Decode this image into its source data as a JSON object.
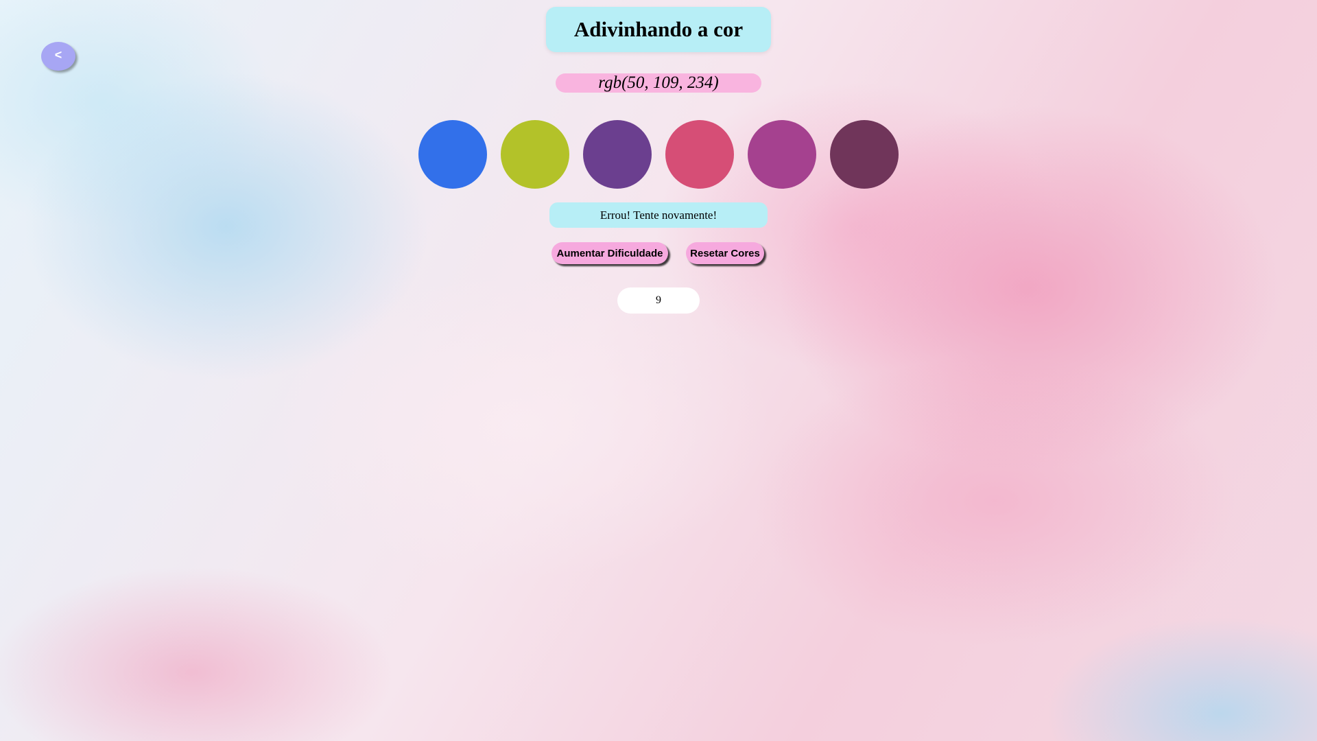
{
  "nav": {
    "back_label": "<"
  },
  "header": {
    "title": "Adivinhando a cor"
  },
  "target": {
    "rgb_text": "rgb(50, 109, 234)"
  },
  "colors": [
    {
      "name": "color-option-1",
      "hex": "#3270ea"
    },
    {
      "name": "color-option-2",
      "hex": "#b3c229"
    },
    {
      "name": "color-option-3",
      "hex": "#6b3f8f"
    },
    {
      "name": "color-option-4",
      "hex": "#d64e76"
    },
    {
      "name": "color-option-5",
      "hex": "#a5418f"
    },
    {
      "name": "color-option-6",
      "hex": "#70355a"
    }
  ],
  "status": {
    "message": "Errou! Tente novamente!"
  },
  "controls": {
    "increase_difficulty_label": "Aumentar Dificuldade",
    "reset_colors_label": "Resetar Cores"
  },
  "score": {
    "value": "9"
  },
  "theme": {
    "title_bg": "#b7eef6",
    "rgb_bg": "#f9b4df",
    "button_bg": "#f6a9de",
    "back_button_bg": "#a7a6f4"
  }
}
